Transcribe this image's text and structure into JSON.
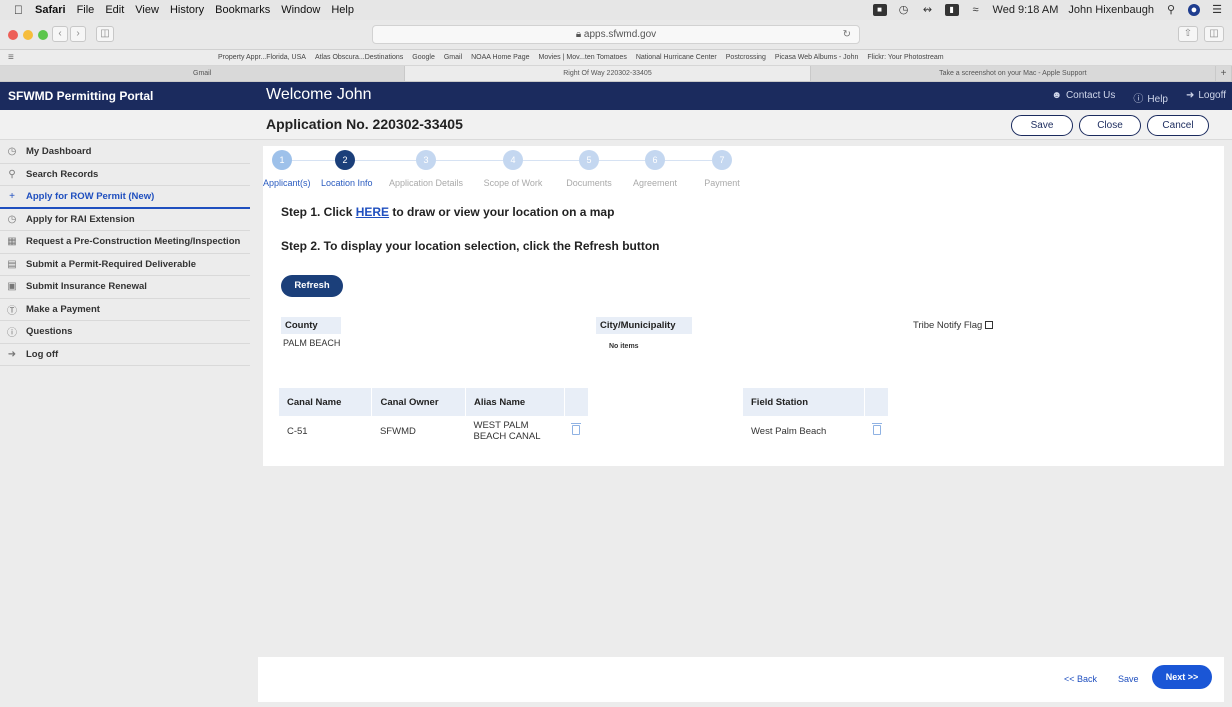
{
  "menubar": {
    "app": "Safari",
    "items": [
      "File",
      "Edit",
      "View",
      "History",
      "Bookmarks",
      "Window",
      "Help"
    ],
    "clock": "Wed 9:18 AM",
    "user": "John Hixenbaugh"
  },
  "browser": {
    "url": "apps.sfwmd.gov",
    "bookmarks": [
      "Property Appr...Florida, USA",
      "Atlas Obscura...Destinations",
      "Google",
      "Gmail",
      "NOAA Home Page",
      "Movies | Mov...ten Tomatoes",
      "National Hurricane Center",
      "Postcrossing",
      "Picasa Web Albums - John",
      "Flickr: Your Photostream"
    ],
    "tabs": [
      {
        "label": "Gmail",
        "active": false
      },
      {
        "label": "Right Of Way 220302-33405",
        "active": true
      },
      {
        "label": "Take a screenshot on your Mac - Apple Support",
        "active": false
      }
    ]
  },
  "header": {
    "portal_title": "SFWMD Permitting Portal",
    "welcome": "Welcome John",
    "contact": "Contact Us",
    "help": "Help",
    "logoff": "Logoff"
  },
  "subheader": {
    "application_no": "Application No. 220302-33405",
    "save": "Save",
    "close": "Close",
    "cancel": "Cancel"
  },
  "nav": [
    {
      "label": "My Dashboard",
      "icon": "dashboard-icon"
    },
    {
      "label": "Search Records",
      "icon": "search-icon"
    },
    {
      "label": "Apply for ROW Permit (New)",
      "icon": "plus-icon"
    },
    {
      "label": "Apply for RAI Extension",
      "icon": "clock-icon"
    },
    {
      "label": "Request a Pre-Construction Meeting/Inspection",
      "icon": "calendar-icon"
    },
    {
      "label": "Submit a Permit-Required Deliverable",
      "icon": "document-icon"
    },
    {
      "label": "Submit Insurance Renewal",
      "icon": "file-icon"
    },
    {
      "label": "Make a Payment",
      "icon": "dollar-icon"
    },
    {
      "label": "Questions",
      "icon": "question-icon"
    },
    {
      "label": "Log off",
      "icon": "logoff-icon"
    }
  ],
  "stepper": [
    {
      "num": "1",
      "label": "Applicant(s)",
      "state": "done"
    },
    {
      "num": "2",
      "label": "Location Info",
      "state": "current"
    },
    {
      "num": "3",
      "label": "Application Details",
      "state": "todo"
    },
    {
      "num": "4",
      "label": "Scope of Work",
      "state": "todo"
    },
    {
      "num": "5",
      "label": "Documents",
      "state": "todo"
    },
    {
      "num": "6",
      "label": "Agreement",
      "state": "todo"
    },
    {
      "num": "7",
      "label": "Payment",
      "state": "todo"
    }
  ],
  "location": {
    "step1_prefix": "Step 1. Click ",
    "step1_link": "HERE",
    "step1_suffix": " to draw or view your location on a map",
    "step2": "Step 2. To display your location selection, click the Refresh button",
    "refresh": "Refresh",
    "county_label": "County",
    "county_value": "PALM BEACH",
    "city_label": "City/Municipality",
    "city_value": "No items",
    "tribe_label": "Tribe Notify Flag"
  },
  "canal_table": {
    "headers": [
      "Canal Name",
      "Canal Owner",
      "Alias Name"
    ],
    "rows": [
      [
        "C-51",
        "SFWMD",
        "WEST PALM BEACH CANAL"
      ]
    ]
  },
  "field_station_table": {
    "header": "Field Station",
    "rows": [
      "West Palm Beach"
    ]
  },
  "footer": {
    "back": "<< Back",
    "save": "Save",
    "next": "Next >>"
  },
  "colors": {
    "header_navy": "#1b2b5e",
    "accent_blue": "#1f4fbf",
    "next_button": "#1a56d6"
  }
}
